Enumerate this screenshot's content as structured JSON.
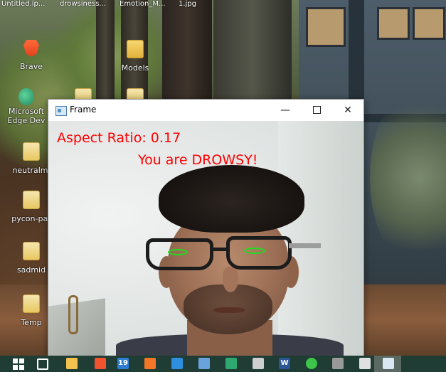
{
  "desktop": {
    "top_labels": [
      "Untitled.ip...",
      "drowsiness...",
      "Emotion_M...",
      "1.jpg"
    ],
    "icons": [
      {
        "label": "Brave",
        "kind": "brave"
      },
      {
        "label": "Models",
        "kind": "folder"
      },
      {
        "label": "Microsoft",
        "label2": "Edge Dev",
        "kind": "edge"
      },
      {
        "label": "neutralmi",
        "kind": "file"
      },
      {
        "label": "pycon-par",
        "kind": "file"
      },
      {
        "label": "sadmid",
        "kind": "file"
      },
      {
        "label": "Temp",
        "kind": "file"
      }
    ]
  },
  "window": {
    "title": "Frame",
    "minimize_symbol": "—",
    "close_symbol": "✕"
  },
  "video_overlay": {
    "aspect_ratio_text": "Aspect Ratio: 0.17",
    "alert_text": "You are DROWSY!",
    "text_color": "#ff0000",
    "eye_contour_color": "#1ce01c"
  },
  "taskbar": {
    "background": "#1f3d35",
    "items": [
      {
        "name": "start",
        "color": "#ffffff"
      },
      {
        "name": "task-view",
        "color": "#ffffff"
      },
      {
        "name": "file-explorer",
        "color": "#f2c14e"
      },
      {
        "name": "brave",
        "color": "#f0532d"
      },
      {
        "name": "calendar-19",
        "color": "#2d7dd2",
        "text": "19"
      },
      {
        "name": "jupyter",
        "color": "#f37726"
      },
      {
        "name": "vscode",
        "color": "#2e8fe0"
      },
      {
        "name": "network-app",
        "color": "#6aa2de"
      },
      {
        "name": "edge-dev",
        "color": "#2ea86f"
      },
      {
        "name": "typora",
        "color": "#cfcfcf"
      },
      {
        "name": "word",
        "color": "#2b5797",
        "text": "W"
      },
      {
        "name": "spotify-like",
        "color": "#3cc44b"
      },
      {
        "name": "terminal",
        "color": "#9a9a9a"
      },
      {
        "name": "photos",
        "color": "#e0e0e0"
      },
      {
        "name": "frame-window",
        "color": "#d9e8f3"
      }
    ]
  }
}
